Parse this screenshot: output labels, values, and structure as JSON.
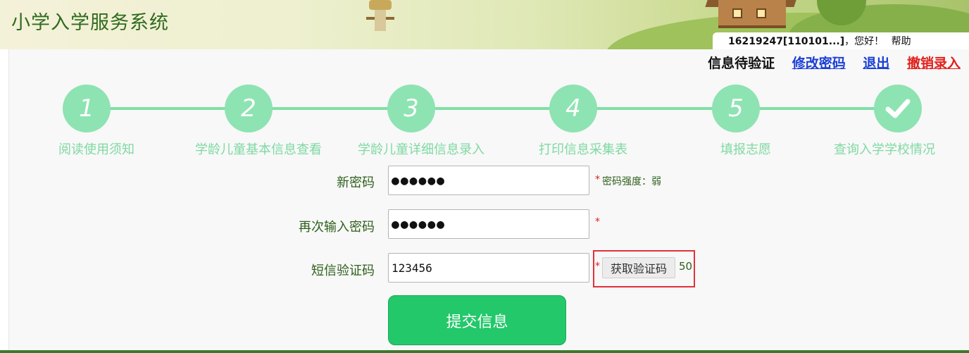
{
  "header": {
    "app_title": "小学入学服务系统",
    "user_id": "16219247[110101...]",
    "greeting": "，您好！",
    "help_label": "帮助"
  },
  "top_links": {
    "status": "信息待验证",
    "change_password": "修改密码",
    "logout": "退出",
    "cancel_entry": "撤销录入"
  },
  "steps": [
    {
      "number": "1",
      "label": "阅读使用须知"
    },
    {
      "number": "2",
      "label": "学龄儿童基本信息查看"
    },
    {
      "number": "3",
      "label": "学龄儿童详细信息录入"
    },
    {
      "number": "4",
      "label": "打印信息采集表"
    },
    {
      "number": "5",
      "label": "填报志愿"
    },
    {
      "number": "",
      "label": "查询入学学校情况"
    }
  ],
  "form": {
    "new_password": {
      "label": "新密码",
      "value": "●●●●●●",
      "required_mark": "*",
      "hint": "密码强度：弱"
    },
    "confirm_password": {
      "label": "再次输入密码",
      "value": "●●●●●●",
      "required_mark": "*"
    },
    "sms_code": {
      "label": "短信验证码",
      "value": "123456",
      "required_mark": "*",
      "button_label": "获取验证码",
      "countdown": "50"
    },
    "submit_label": "提交信息"
  },
  "colors": {
    "step_circle": "#8ee3b2",
    "step_label": "#7fd9a3",
    "submit_button": "#23c86a",
    "link_blue": "#1a3fd6",
    "danger_red": "#e0201c",
    "label_green": "#2e5f1c"
  }
}
